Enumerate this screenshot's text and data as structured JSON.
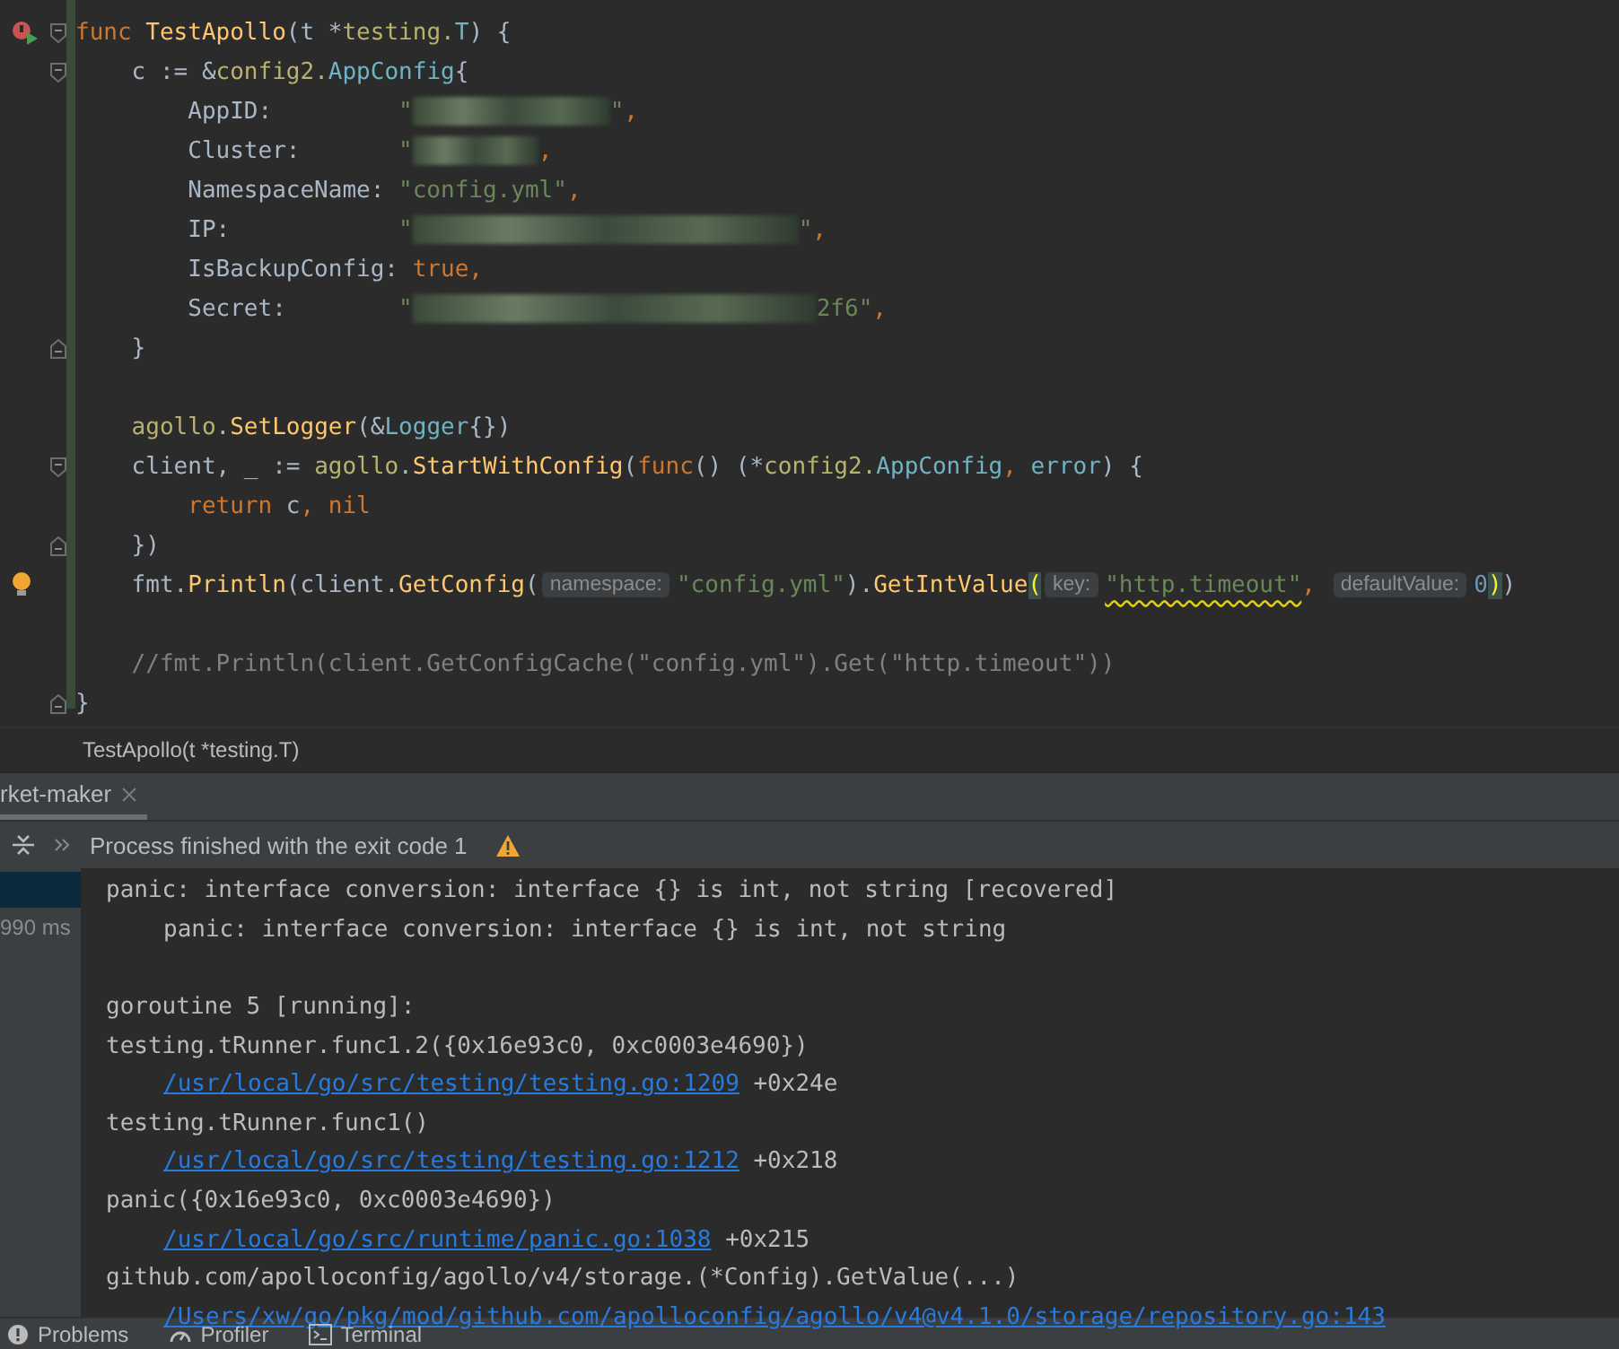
{
  "editor": {
    "blocks": [
      {
        "lines": [
          {
            "run_marker": true,
            "fold_start": true,
            "tokens": [
              {
                "kind": "kw",
                "text": "func "
              },
              {
                "kind": "fn",
                "text": "TestApollo"
              },
              {
                "kind": "plain",
                "text": "(t *"
              },
              {
                "kind": "pkg",
                "text": "testing."
              },
              {
                "kind": "type",
                "text": "T"
              },
              {
                "kind": "plain",
                "text": ") {"
              }
            ]
          },
          {
            "fold_start": true,
            "tokens": [
              {
                "kind": "plain",
                "text": "    c := &"
              },
              {
                "kind": "pkg",
                "text": "config2."
              },
              {
                "kind": "type",
                "text": "AppConfig"
              },
              {
                "kind": "plain",
                "text": "{"
              }
            ]
          },
          {
            "tokens": [
              {
                "kind": "plain",
                "text": "        AppID:         "
              },
              {
                "kind": "str",
                "text": "\""
              },
              {
                "kind": "blurmedium"
              },
              {
                "kind": "str",
                "text": "\""
              },
              {
                "kind": "kw",
                "text": ","
              }
            ]
          },
          {
            "tokens": [
              {
                "kind": "plain",
                "text": "        Cluster:       "
              },
              {
                "kind": "str",
                "text": "\""
              },
              {
                "kind": "blurshort"
              },
              {
                "kind": "kw",
                "text": ","
              }
            ]
          },
          {
            "tokens": [
              {
                "kind": "plain",
                "text": "        NamespaceName: "
              },
              {
                "kind": "str",
                "text": "\"config.yml\""
              },
              {
                "kind": "kw",
                "text": ","
              }
            ]
          },
          {
            "tokens": [
              {
                "kind": "plain",
                "text": "        IP:            "
              },
              {
                "kind": "str",
                "text": "\""
              },
              {
                "kind": "blurlong"
              },
              {
                "kind": "str",
                "text": "\""
              },
              {
                "kind": "kw",
                "text": ","
              }
            ]
          },
          {
            "tokens": [
              {
                "kind": "plain",
                "text": "        IsBackupConfig: "
              },
              {
                "kind": "kw",
                "text": "true,"
              }
            ]
          },
          {
            "tokens": [
              {
                "kind": "plain",
                "text": "        Secret:        "
              },
              {
                "kind": "str",
                "text": "\""
              },
              {
                "kind": "blurwide"
              },
              {
                "kind": "str",
                "text": "2f6\""
              },
              {
                "kind": "kw",
                "text": ","
              }
            ]
          },
          {
            "fold_end": true,
            "tokens": [
              {
                "kind": "plain",
                "text": "    }"
              }
            ]
          }
        ]
      },
      {
        "lines": [
          {
            "tokens": [
              {
                "kind": "pkg",
                "text": "    agollo"
              },
              {
                "kind": "plain",
                "text": "."
              },
              {
                "kind": "fn",
                "text": "SetLogger"
              },
              {
                "kind": "plain",
                "text": "(&"
              },
              {
                "kind": "type",
                "text": "Logger"
              },
              {
                "kind": "plain",
                "text": "{})"
              }
            ]
          },
          {
            "fold_start": true,
            "tokens": [
              {
                "kind": "plain",
                "text": "    client, _ := "
              },
              {
                "kind": "pkg",
                "text": "agollo"
              },
              {
                "kind": "plain",
                "text": "."
              },
              {
                "kind": "fn",
                "text": "StartWithConfig"
              },
              {
                "kind": "plain",
                "text": "("
              },
              {
                "kind": "kw",
                "text": "func"
              },
              {
                "kind": "plain",
                "text": "() (*"
              },
              {
                "kind": "pkg",
                "text": "config2."
              },
              {
                "kind": "type",
                "text": "AppConfig"
              },
              {
                "kind": "kw",
                "text": ", "
              },
              {
                "kind": "type",
                "text": "error"
              },
              {
                "kind": "plain",
                "text": ") {"
              }
            ]
          },
          {
            "tokens": [
              {
                "kind": "kw",
                "text": "        return "
              },
              {
                "kind": "plain",
                "text": "c"
              },
              {
                "kind": "kw",
                "text": ", nil"
              }
            ]
          },
          {
            "fold_end": true,
            "tokens": [
              {
                "kind": "plain",
                "text": "    })"
              }
            ]
          },
          {
            "bulb": true,
            "tokens": [
              {
                "kind": "plain",
                "text": "    fmt."
              },
              {
                "kind": "fn",
                "text": "Println"
              },
              {
                "kind": "plain",
                "text": "(client."
              },
              {
                "kind": "fn",
                "text": "GetConfig"
              },
              {
                "kind": "plain",
                "text": "("
              },
              {
                "kind": "hint",
                "text": "namespace:"
              },
              {
                "kind": "str",
                "text": "\"config.yml\""
              },
              {
                "kind": "plain",
                "text": ")."
              },
              {
                "kind": "fn",
                "text": "GetIntValue"
              },
              {
                "kind": "brace",
                "text": "("
              },
              {
                "kind": "hint",
                "text": "key:"
              },
              {
                "kind": "warn",
                "text": "\"http.timeout\""
              },
              {
                "kind": "kw",
                "text": ", "
              },
              {
                "kind": "hint",
                "text": "defaultValue:"
              },
              {
                "kind": "num",
                "text": "0"
              },
              {
                "kind": "brace",
                "text": ")"
              },
              {
                "kind": "plain",
                "text": ")"
              }
            ]
          }
        ]
      },
      {
        "lines": [
          {
            "tokens": [
              {
                "kind": "comment",
                "text": "    //fmt.Println(client.GetConfigCache(\"config.yml\").Get(\"http.timeout\"))"
              }
            ]
          },
          {
            "fold_end": true,
            "tokens": [
              {
                "kind": "plain",
                "text": "}"
              }
            ]
          }
        ]
      }
    ]
  },
  "breadcrumb": "TestApollo(t *testing.T)",
  "run_tabs": [
    {
      "label": "rket-maker",
      "selected": true
    }
  ],
  "toolbar": {
    "status": "Process finished with the exit code 1"
  },
  "test_panel": {
    "duration": "990 ms"
  },
  "console": {
    "blocks": [
      {
        "lines": [
          {
            "kind": "flush",
            "tokens": [
              {
                "kind": "text",
                "text": "panic: interface conversion: interface {} is int, not string [recovered]"
              }
            ]
          },
          {
            "kind": "indented",
            "tokens": [
              {
                "kind": "text",
                "text": "panic: interface conversion: interface {} is int, not string"
              }
            ]
          }
        ]
      },
      {
        "lines": [
          {
            "kind": "flush",
            "tokens": [
              {
                "kind": "text",
                "text": "goroutine 5 [running]:"
              }
            ]
          },
          {
            "kind": "flush",
            "tokens": [
              {
                "kind": "text",
                "text": "testing.tRunner.func1.2({0x16e93c0, 0xc0003e4690})"
              }
            ]
          },
          {
            "kind": "indented",
            "tokens": [
              {
                "kind": "link",
                "text": "/usr/local/go/src/testing/testing.go:1209"
              },
              {
                "kind": "text",
                "text": " +0x24e"
              }
            ]
          },
          {
            "kind": "flush",
            "tokens": [
              {
                "kind": "text",
                "text": "testing.tRunner.func1()"
              }
            ]
          },
          {
            "kind": "indented",
            "tokens": [
              {
                "kind": "link",
                "text": "/usr/local/go/src/testing/testing.go:1212"
              },
              {
                "kind": "text",
                "text": " +0x218"
              }
            ]
          },
          {
            "kind": "flush",
            "tokens": [
              {
                "kind": "text",
                "text": "panic({0x16e93c0, 0xc0003e4690})"
              }
            ]
          },
          {
            "kind": "indented",
            "tokens": [
              {
                "kind": "link",
                "text": "/usr/local/go/src/runtime/panic.go:1038"
              },
              {
                "kind": "text",
                "text": " +0x215"
              }
            ]
          },
          {
            "kind": "flush",
            "tokens": [
              {
                "kind": "text",
                "text": "github.com/apolloconfig/agollo/v4/storage.(*Config).GetValue(...)"
              }
            ]
          },
          {
            "kind": "indented",
            "tokens": [
              {
                "kind": "link",
                "text": "/Users/xw/go/pkg/mod/github.com/apolloconfig/agollo/v4@v4.1.0/storage/repository.go:143"
              }
            ]
          }
        ]
      }
    ]
  },
  "bottom_tools": [
    {
      "kind": "problems",
      "label": "Problems"
    },
    {
      "kind": "profiler",
      "label": "Profiler"
    },
    {
      "kind": "terminal",
      "label": "Terminal"
    }
  ]
}
